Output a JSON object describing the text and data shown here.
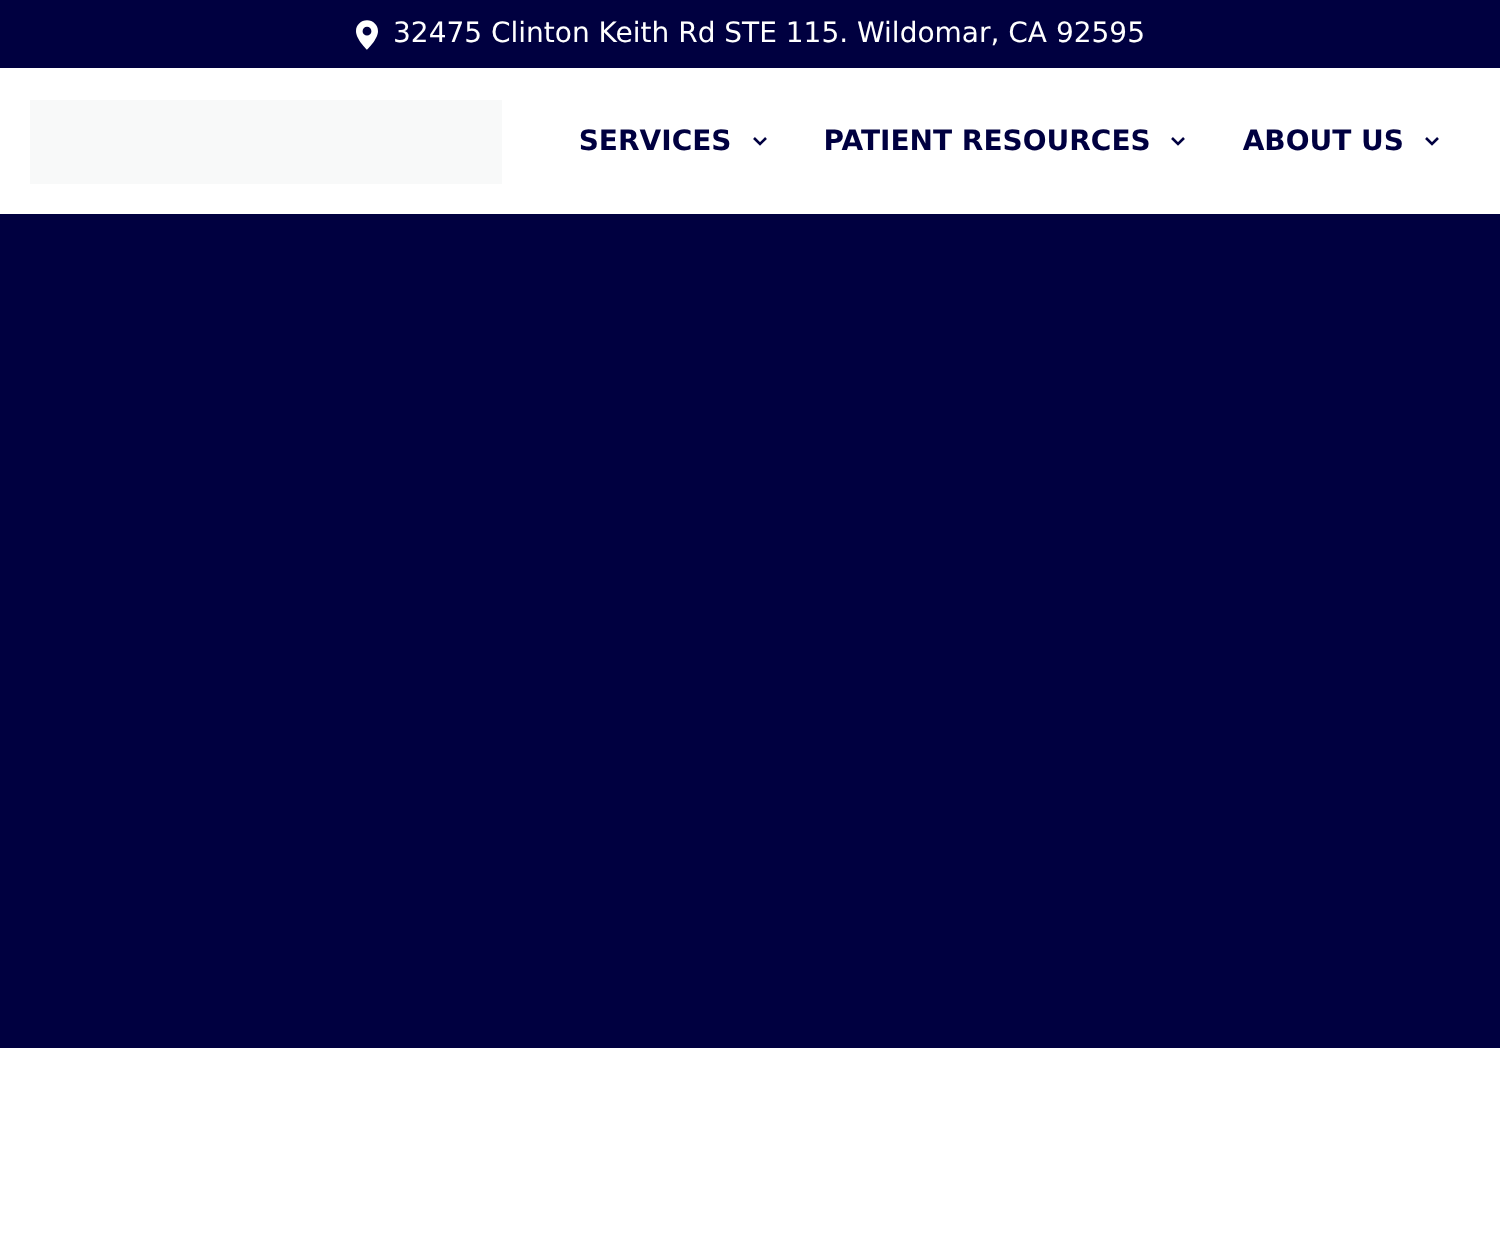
{
  "top_bar": {
    "address": "32475 Clinton Keith Rd STE 115. Wildomar, CA 92595"
  },
  "nav": {
    "items": [
      {
        "label": "SERVICES"
      },
      {
        "label": "PATIENT RESOURCES"
      },
      {
        "label": "ABOUT US"
      }
    ]
  }
}
